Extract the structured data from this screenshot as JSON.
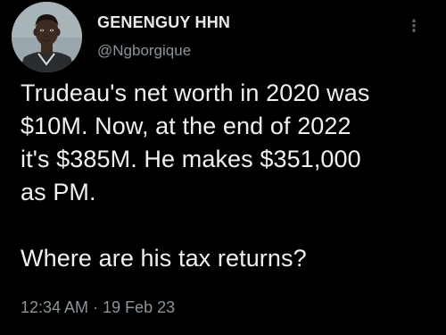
{
  "author": {
    "display_name": "GENENGUY HHN",
    "handle": "@Ngborgique"
  },
  "more_icon": "more-vertical-icon",
  "more_glyph": "⋮",
  "tweet": {
    "line_1": "Trudeau's net worth in 2020 was",
    "line_2": "$10M. Now, at the end of 2022",
    "line_3": "it's $385M. He makes $351,000",
    "line_4": "as PM.",
    "line_5": "Where are his tax returns?"
  },
  "meta": {
    "time": "12:34 AM",
    "separator": "·",
    "date": "19 Feb 23"
  },
  "colors": {
    "background": "#000000",
    "text": "#e7e9ea",
    "secondary_text": "#8b949a"
  }
}
